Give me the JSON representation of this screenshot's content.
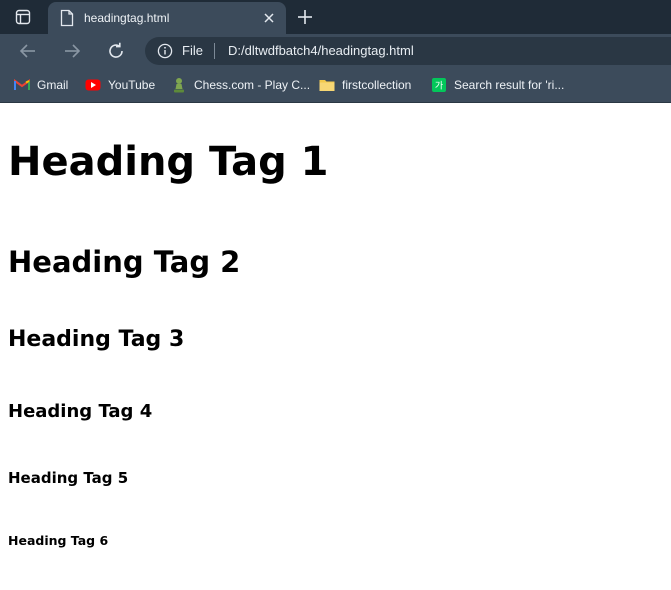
{
  "tab": {
    "title": "headingtag.html"
  },
  "address_bar": {
    "scheme_label": "File",
    "url": "D:/dltwdfbatch4/headingtag.html"
  },
  "bookmarks": [
    {
      "label": "Gmail",
      "icon": "gmail-icon"
    },
    {
      "label": "YouTube",
      "icon": "youtube-icon"
    },
    {
      "label": "Chess.com - Play C...",
      "icon": "chess-pawn-icon"
    },
    {
      "label": "firstcollection",
      "icon": "folder-icon"
    },
    {
      "label": "Search result for 'ri...",
      "icon": "search-result-icon"
    }
  ],
  "headings": [
    "Heading Tag 1",
    "Heading Tag 2",
    "Heading Tag 3",
    "Heading Tag 4",
    "Heading Tag 5",
    "Heading Tag 6"
  ],
  "colors": {
    "tabstrip": "#1f2b37",
    "toolbar": "#3c4b5b",
    "omnibox": "#2a3744",
    "page_background": "#ffffff"
  }
}
